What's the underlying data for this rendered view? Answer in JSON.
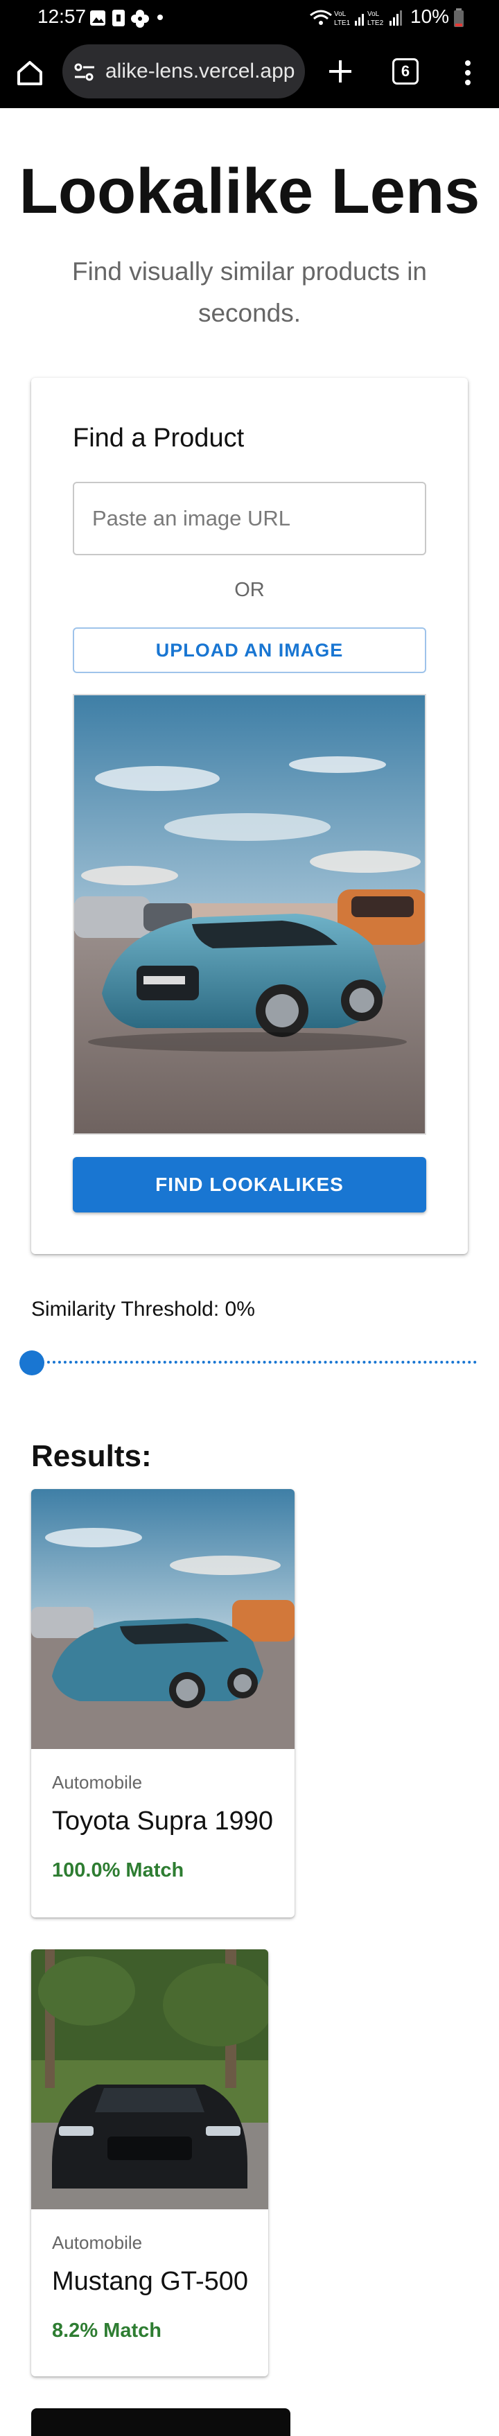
{
  "status_bar": {
    "time": "12:57",
    "battery": "10%"
  },
  "browser": {
    "url": "alike-lens.vercel.app",
    "tab_count": "6"
  },
  "page": {
    "title": "Lookalike Lens",
    "subtitle": "Find visually similar products in seconds."
  },
  "search_card": {
    "title": "Find a Product",
    "url_placeholder": "Paste an image URL",
    "or_text": "OR",
    "upload_label": "UPLOAD AN IMAGE",
    "find_label": "FIND LOOKALIKES"
  },
  "threshold": {
    "label": "Similarity Threshold: 0%",
    "value": 0
  },
  "results": {
    "heading": "Results:",
    "items": [
      {
        "category": "Automobile",
        "name": "Toyota Supra 1990",
        "match": "100.0% Match"
      },
      {
        "category": "Automobile",
        "name": "Mustang GT-500",
        "match": "8.2% Match"
      }
    ]
  },
  "colors": {
    "primary": "#1976d2",
    "match_green": "#2e7d32",
    "supra_blue": "#3b7f9a",
    "mustang_black": "#1a1c1f"
  }
}
